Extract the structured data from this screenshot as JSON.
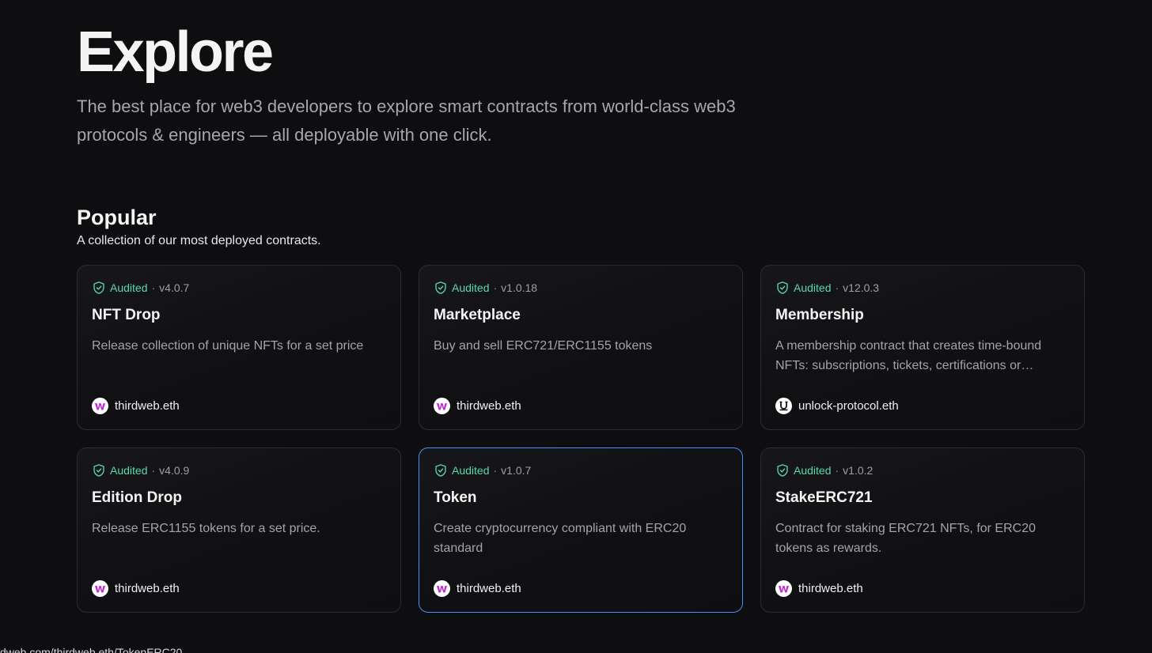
{
  "hero": {
    "title": "Explore",
    "subtitle": "The best place for web3 developers to explore smart contracts from world-class web3 protocols & engineers — all deployable with one click."
  },
  "popular": {
    "title": "Popular",
    "subtitle": "A collection of our most deployed contracts.",
    "cards": [
      {
        "audited": "Audited",
        "separator": "·",
        "version": "v4.0.7",
        "title": "NFT Drop",
        "description": "Release collection of unique NFTs for a set price",
        "publisher": "thirdweb.eth",
        "avatar_icon": "thirdweb-logo-icon"
      },
      {
        "audited": "Audited",
        "separator": "·",
        "version": "v1.0.18",
        "title": "Marketplace",
        "description": "Buy and sell ERC721/ERC1155 tokens",
        "publisher": "thirdweb.eth",
        "avatar_icon": "thirdweb-logo-icon"
      },
      {
        "audited": "Audited",
        "separator": "·",
        "version": "v12.0.3",
        "title": "Membership",
        "description": "A membership contract that creates time-bound NFTs: subscriptions, tickets, certifications or…",
        "publisher": "unlock-protocol.eth",
        "avatar_icon": "unlock-logo-icon"
      },
      {
        "audited": "Audited",
        "separator": "·",
        "version": "v4.0.9",
        "title": "Edition Drop",
        "description": "Release ERC1155 tokens for a set price.",
        "publisher": "thirdweb.eth",
        "avatar_icon": "thirdweb-logo-icon"
      },
      {
        "audited": "Audited",
        "separator": "·",
        "version": "v1.0.7",
        "title": "Token",
        "description": "Create cryptocurrency compliant with ERC20 standard",
        "publisher": "thirdweb.eth",
        "avatar_icon": "thirdweb-logo-icon"
      },
      {
        "audited": "Audited",
        "separator": "·",
        "version": "v1.0.2",
        "title": "StakeERC721",
        "description": "Contract for staking ERC721 NFTs, for ERC20 tokens as rewards.",
        "publisher": "thirdweb.eth",
        "avatar_icon": "thirdweb-logo-icon"
      }
    ]
  },
  "status_bar": {
    "url": "dweb.com/thirdweb.eth/TokenERC20"
  },
  "colors": {
    "background": "#0e0e11",
    "audited_green": "#58d9a8",
    "hover_border_blue": "#4a8ef5",
    "thirdweb_brand": "#c026d3"
  }
}
